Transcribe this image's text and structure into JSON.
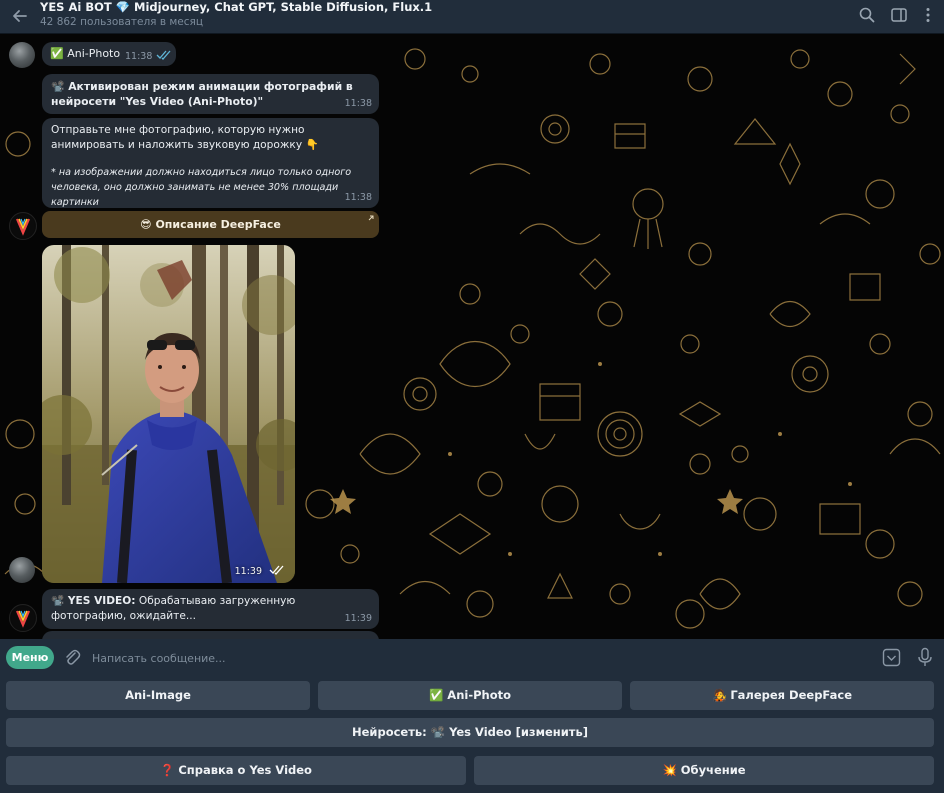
{
  "header": {
    "title": "YES Ai BOT 💎 Midjourney, Chat GPT, Stable Diffusion, Flux.1",
    "subtitle": "42 862 пользователя в месяц",
    "icons": [
      "back-arrow-icon",
      "search-icon",
      "sidebar-toggle-icon",
      "more-vertical-icon"
    ]
  },
  "messages": {
    "m1": {
      "text": "✅ Ani-Photo",
      "time": "11:38"
    },
    "m2": {
      "text": "📽️ Активирован режим анимации фотографий в нейросети \"Yes Video (Ani-Photo)\"",
      "time": "11:38"
    },
    "m3": {
      "line1": "Отправьте мне фотографию, которую нужно анимировать и наложить звуковую дорожку 👇",
      "line2": "* на изображении должно находиться лицо только одного человека, оно должно занимать не менее 30% площади картинки",
      "time": "11:38"
    },
    "inline_button": "😎 Описание DeepFace",
    "photo": {
      "time": "11:39"
    },
    "m4": {
      "prefix": "📽️ YES VIDEO:",
      "text": " Обрабатываю загруженную фотографию, ожидайте...",
      "time": "11:39"
    }
  },
  "input": {
    "menu_label": "Меню",
    "placeholder": "Написать сообщение..."
  },
  "keyboard": {
    "row1": [
      "Ani-Image",
      "✅ Ani-Photo",
      "🧑‍🎤 Галерея DeepFace"
    ],
    "row2": [
      "Нейросеть: 📽️ Yes Video [изменить]"
    ],
    "row3": [
      "❓ Справка о Yes Video",
      "💥 Обучение"
    ]
  },
  "colors": {
    "header_bg": "#212d3b",
    "bubble_bg": "#252c35",
    "menu_green": "#41a88b",
    "wallpaper_gold": "#b8934d",
    "key_bg": "#3a4756"
  }
}
